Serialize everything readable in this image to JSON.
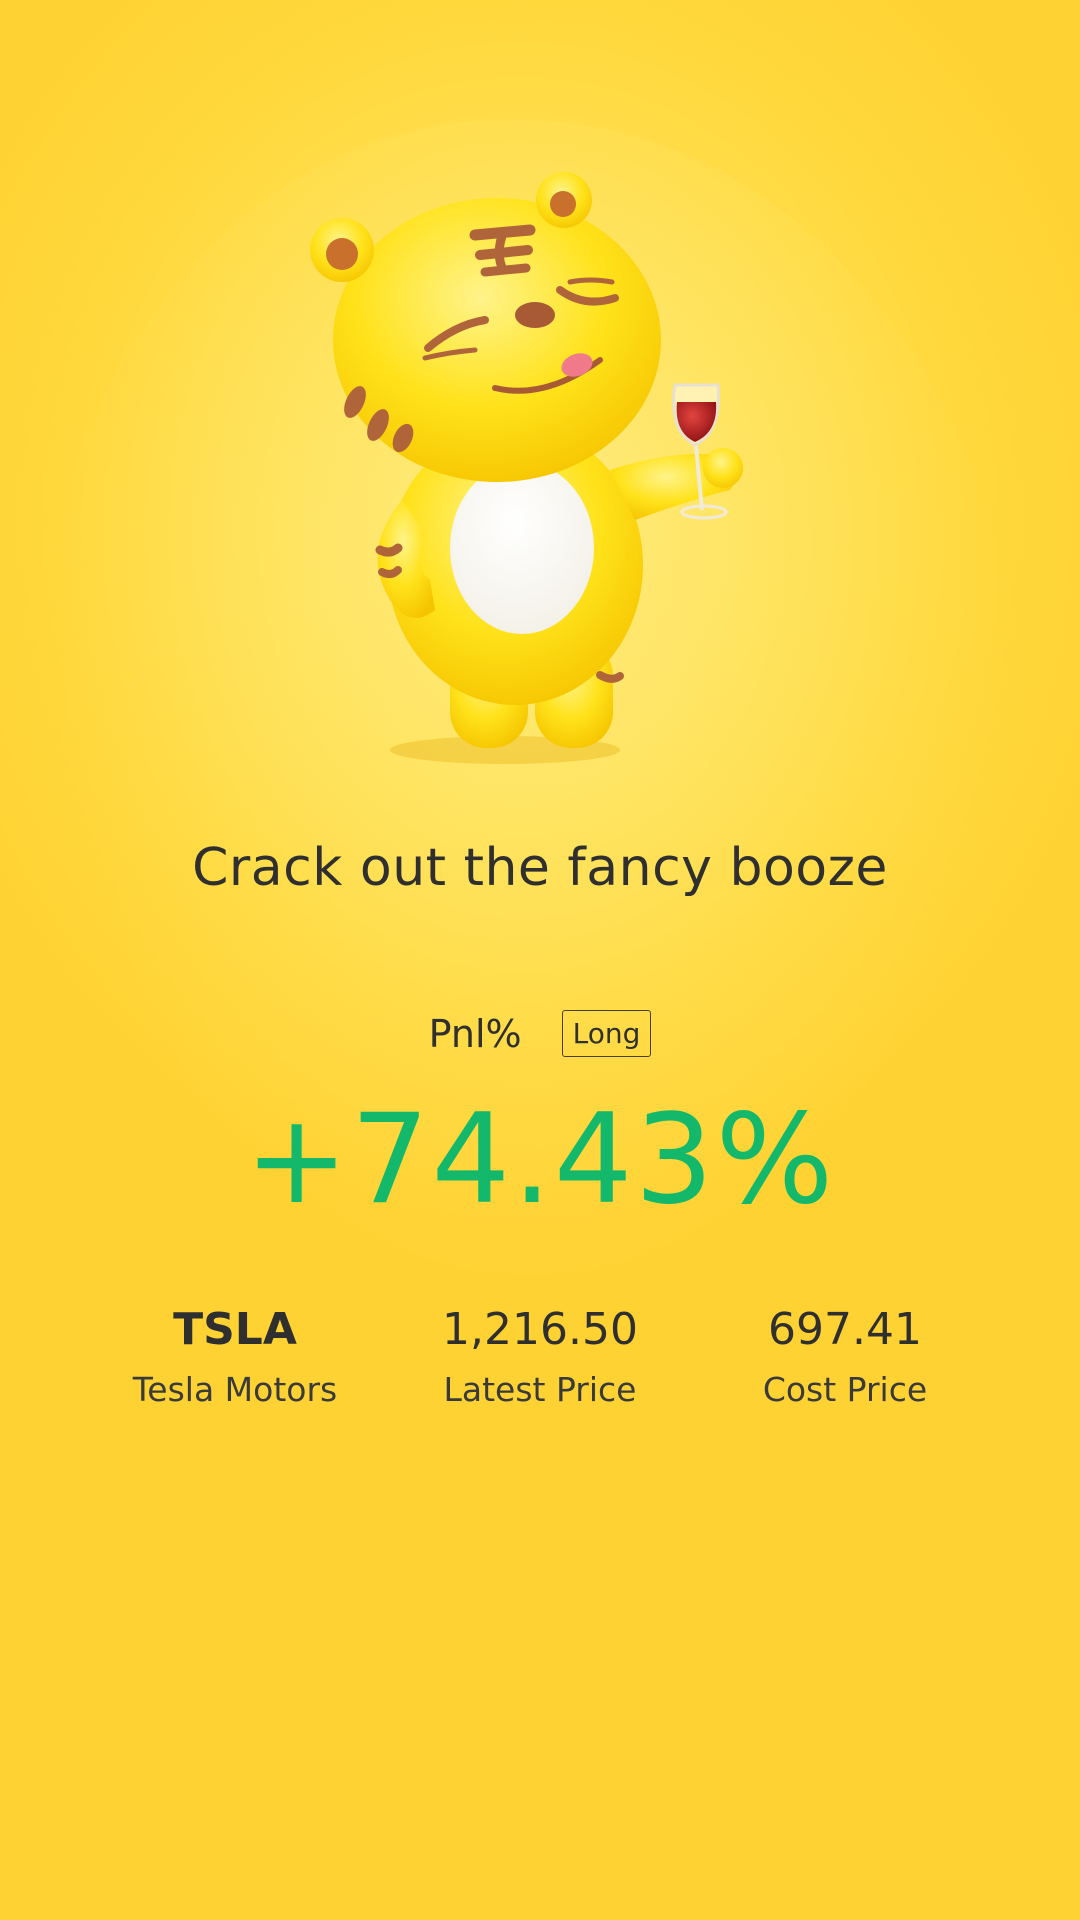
{
  "headline": "Crack out the fancy booze",
  "pnl": {
    "label": "Pnl%",
    "position_badge": "Long",
    "value": "+74.43%",
    "value_color": "#14b86a"
  },
  "stock": {
    "ticker": "TSLA",
    "name": "Tesla Motors",
    "latest_price": "1,216.50",
    "latest_price_label": "Latest Price",
    "cost_price": "697.41",
    "cost_price_label": "Cost Price"
  },
  "mascot": {
    "icon": "tiger-mascot-with-wine-glass"
  },
  "colors": {
    "background": "#ffd93e",
    "text": "#2f2f2f",
    "profit": "#14b86a"
  }
}
